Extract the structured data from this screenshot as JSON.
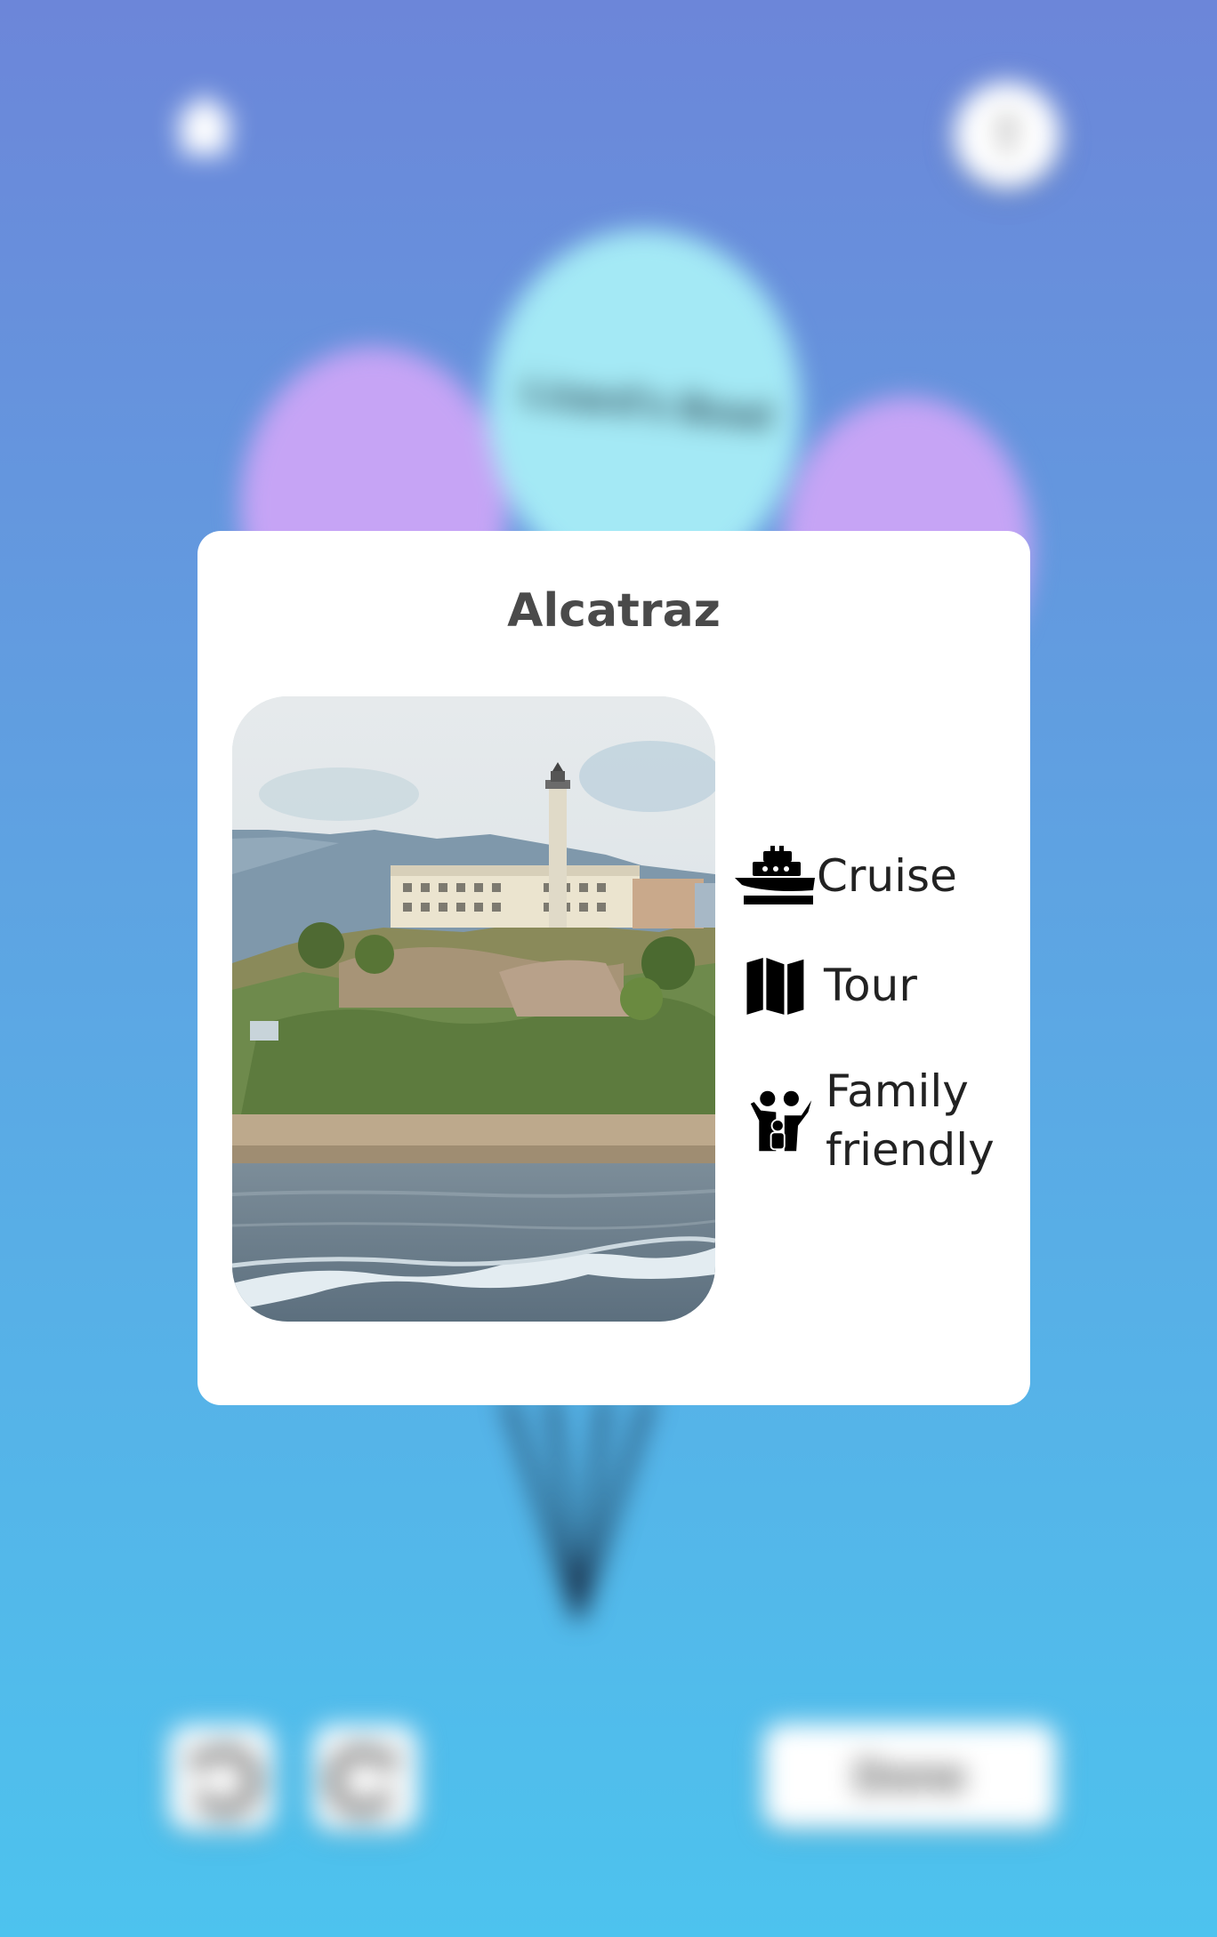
{
  "background": {
    "balloon_label": "Lizard's Bowl",
    "done_label": "Done",
    "icons": [
      "home-icon",
      "profile-icon",
      "undo-icon",
      "redo-icon"
    ]
  },
  "modal": {
    "title": "Alcatraz",
    "tags": [
      {
        "label": "Cruise",
        "icon": "ship-icon"
      },
      {
        "label": "Tour",
        "icon": "map-icon"
      },
      {
        "label": "Family",
        "label2": "friendly",
        "icon": "family-icon"
      }
    ]
  },
  "colors": {
    "bg_top": "#6c86d9",
    "bg_bottom": "#4dc3ee",
    "balloon_cyan": "#a4e9f5",
    "balloon_purple": "#c6a4f5",
    "card": "#ffffff"
  }
}
